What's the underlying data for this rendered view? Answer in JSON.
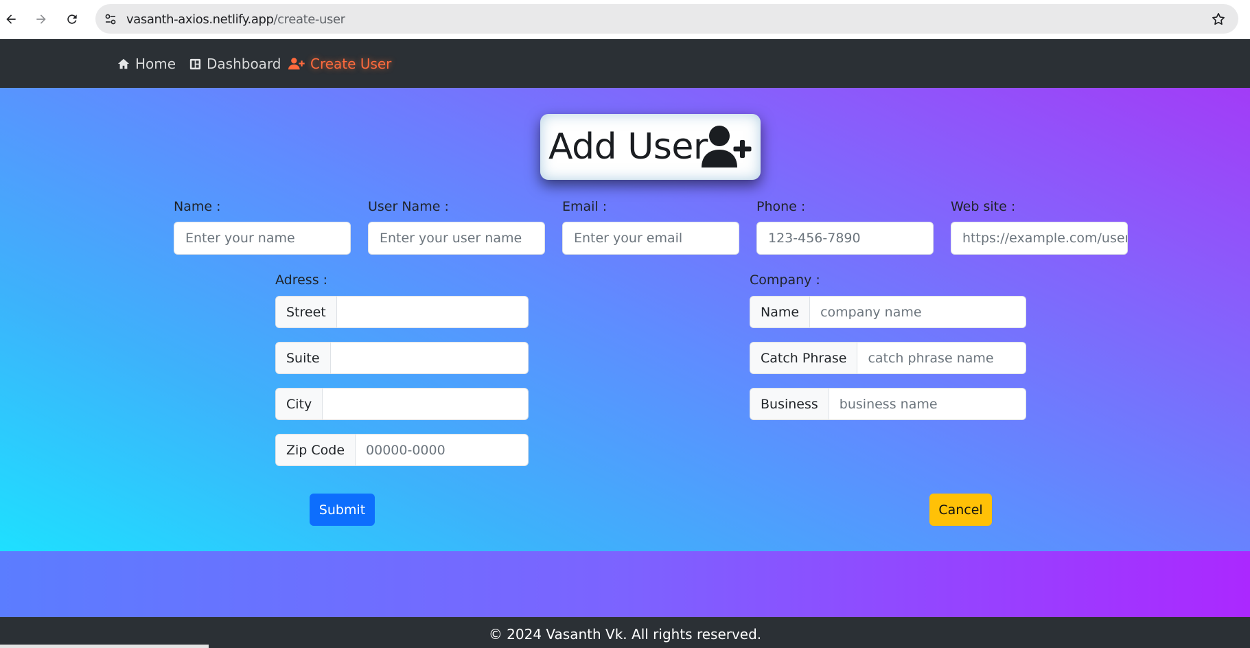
{
  "browser": {
    "url_host": "vasanth-axios.netlify.app",
    "url_path": "/create-user"
  },
  "navbar": {
    "items": [
      {
        "label": "Home",
        "icon": "home-icon"
      },
      {
        "label": "Dashboard",
        "icon": "dashboard-icon"
      },
      {
        "label": "Create User",
        "icon": "user-plus-icon",
        "active": true
      }
    ],
    "active_color": "#ff6a3d"
  },
  "form": {
    "title": "Add User",
    "fields": {
      "name": {
        "label": "Name :",
        "placeholder": "Enter your name"
      },
      "username": {
        "label": "User Name :",
        "placeholder": "Enter your user name"
      },
      "email": {
        "label": "Email :",
        "placeholder": "Enter your email"
      },
      "phone": {
        "label": "Phone :",
        "placeholder": "123-456-7890"
      },
      "website": {
        "label": "Web site :",
        "placeholder": "https://example.com/user"
      }
    },
    "address": {
      "label": "Adress :",
      "street": {
        "addon": "Street",
        "placeholder": ""
      },
      "suite": {
        "addon": "Suite",
        "placeholder": ""
      },
      "city": {
        "addon": "City",
        "placeholder": ""
      },
      "zip": {
        "addon": "Zip Code",
        "placeholder": "00000-0000"
      }
    },
    "company": {
      "label": "Company :",
      "name": {
        "addon": "Name",
        "placeholder": "company name"
      },
      "catch_phrase": {
        "addon": "Catch Phrase",
        "placeholder": "catch phrase name"
      },
      "business": {
        "addon": "Business",
        "placeholder": "business name"
      }
    },
    "submit_label": "Submit",
    "cancel_label": "Cancel"
  },
  "footer": {
    "text": "© 2024 Vasanth Vk. All rights reserved."
  }
}
